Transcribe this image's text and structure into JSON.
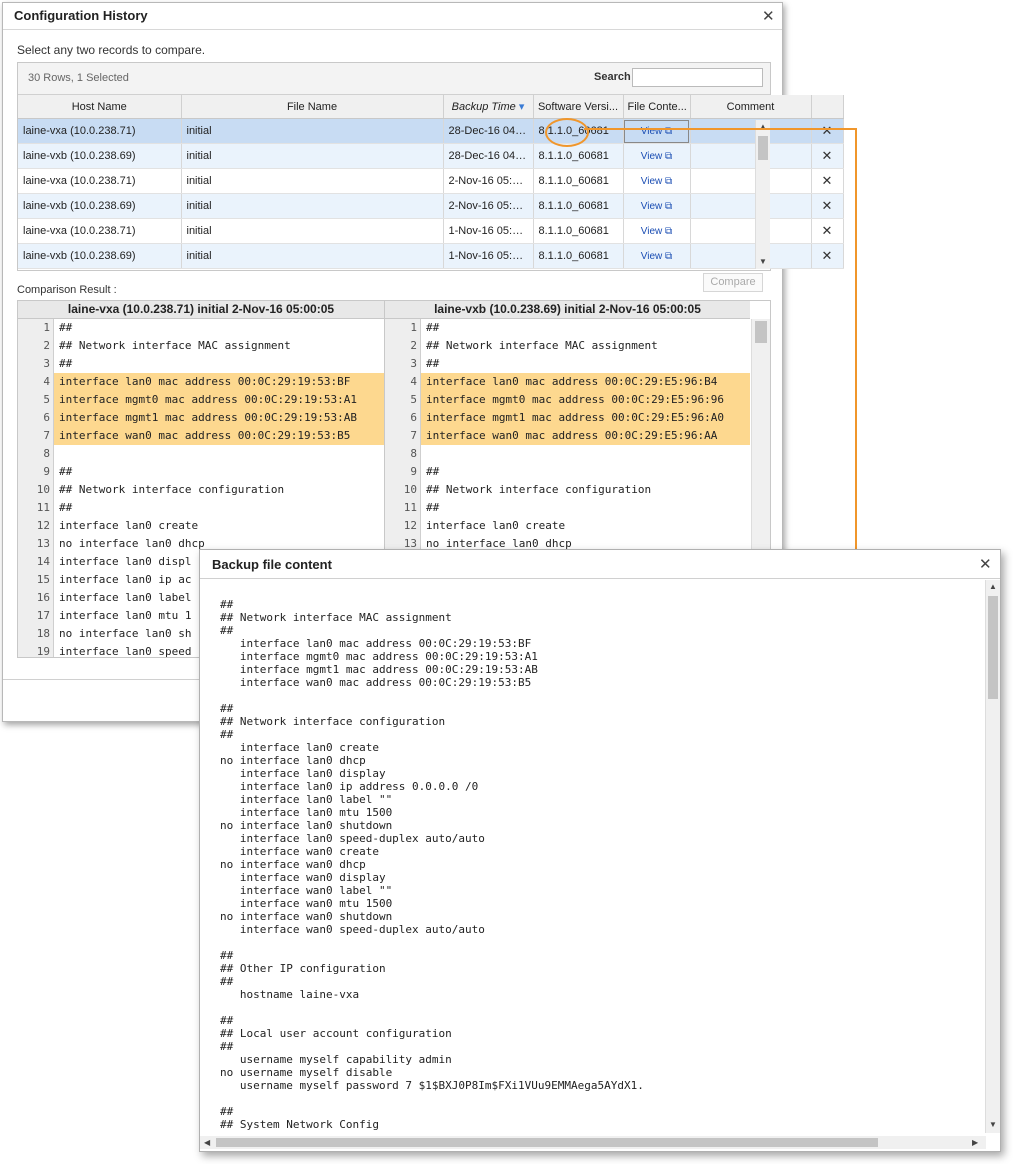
{
  "history": {
    "title": "Configuration History",
    "close_glyph": "✕",
    "instruction": "Select any two records to compare.",
    "rows_info": "30 Rows, 1 Selected",
    "search_label": "Search",
    "search_value": "",
    "columns": [
      "Host Name",
      "File Name",
      "Backup Time",
      "Software Versi...",
      "File Conte...",
      "Comment",
      ""
    ],
    "sort_indicator": "▾",
    "rows": [
      {
        "host": "laine-vxa (10.0.238.71)",
        "file": "initial",
        "time": "28-Dec-16 04:0...",
        "version": "8.1.1.0_60681",
        "content": "View ⧉",
        "comment": "",
        "delete": "✕"
      },
      {
        "host": "laine-vxb (10.0.238.69)",
        "file": "initial",
        "time": "28-Dec-16 04:00:...",
        "version": "8.1.1.0_60681",
        "content": "View ⧉",
        "comment": "",
        "delete": "✕"
      },
      {
        "host": "laine-vxa (10.0.238.71)",
        "file": "initial",
        "time": "2-Nov-16 05:00:...",
        "version": "8.1.1.0_60681",
        "content": "View ⧉",
        "comment": "",
        "delete": "✕"
      },
      {
        "host": "laine-vxb (10.0.238.69)",
        "file": "initial",
        "time": "2-Nov-16 05:00:...",
        "version": "8.1.1.0_60681",
        "content": "View ⧉",
        "comment": "",
        "delete": "✕"
      },
      {
        "host": "laine-vxa (10.0.238.71)",
        "file": "initial",
        "time": "1-Nov-16 05:00:...",
        "version": "8.1.1.0_60681",
        "content": "View ⧉",
        "comment": "",
        "delete": "✕"
      },
      {
        "host": "laine-vxb (10.0.238.69)",
        "file": "initial",
        "time": "1-Nov-16 05:00:...",
        "version": "8.1.1.0_60681",
        "content": "View ⧉",
        "comment": "",
        "delete": "✕"
      }
    ],
    "compare_label": "Compare",
    "comparison_label": "Comparison Result :",
    "left_header": "laine-vxa (10.0.238.71) initial 2-Nov-16 05:00:05",
    "right_header": "laine-vxb (10.0.238.69) initial 2-Nov-16 05:00:05",
    "left_lines": [
      {
        "n": "1",
        "t": "##",
        "hl": false
      },
      {
        "n": "2",
        "t": "## Network interface MAC assignment",
        "hl": false
      },
      {
        "n": "3",
        "t": "##",
        "hl": false
      },
      {
        "n": "4",
        "t": "interface lan0 mac address 00:0C:29:19:53:BF",
        "hl": true
      },
      {
        "n": "5",
        "t": "interface mgmt0 mac address 00:0C:29:19:53:A1",
        "hl": true
      },
      {
        "n": "6",
        "t": "interface mgmt1 mac address 00:0C:29:19:53:AB",
        "hl": true
      },
      {
        "n": "7",
        "t": "interface wan0 mac address 00:0C:29:19:53:B5",
        "hl": true
      },
      {
        "n": "8",
        "t": "",
        "hl": false
      },
      {
        "n": "9",
        "t": "##",
        "hl": false
      },
      {
        "n": "10",
        "t": "## Network interface configuration",
        "hl": false
      },
      {
        "n": "11",
        "t": "##",
        "hl": false
      },
      {
        "n": "12",
        "t": "interface lan0 create",
        "hl": false
      },
      {
        "n": "13",
        "t": "no interface lan0 dhcp",
        "hl": false
      },
      {
        "n": "14",
        "t": "interface lan0 displ",
        "hl": false
      },
      {
        "n": "15",
        "t": "interface lan0 ip ac",
        "hl": false
      },
      {
        "n": "16",
        "t": "interface lan0 label",
        "hl": false
      },
      {
        "n": "17",
        "t": "interface lan0 mtu 1",
        "hl": false
      },
      {
        "n": "18",
        "t": "no interface lan0 sh",
        "hl": false
      },
      {
        "n": "19",
        "t": "interface lan0 speed",
        "hl": false
      }
    ],
    "right_lines": [
      {
        "n": "1",
        "t": "##",
        "hl": false
      },
      {
        "n": "2",
        "t": "## Network interface MAC assignment",
        "hl": false
      },
      {
        "n": "3",
        "t": "##",
        "hl": false
      },
      {
        "n": "4",
        "t": "interface lan0 mac address 00:0C:29:E5:96:B4",
        "hl": true
      },
      {
        "n": "5",
        "t": "interface mgmt0 mac address 00:0C:29:E5:96:96",
        "hl": true
      },
      {
        "n": "6",
        "t": "interface mgmt1 mac address 00:0C:29:E5:96:A0",
        "hl": true
      },
      {
        "n": "7",
        "t": "interface wan0 mac address 00:0C:29:E5:96:AA",
        "hl": true
      },
      {
        "n": "8",
        "t": "",
        "hl": false
      },
      {
        "n": "10",
        "t": "## Network interface configuration",
        "hl": false
      },
      {
        "n": "11",
        "t": "##",
        "hl": false
      },
      {
        "n": "12",
        "t": "interface lan0 create",
        "hl": false
      },
      {
        "n": "13",
        "t": "no interface lan0 dhcp",
        "hl": false
      }
    ],
    "right_line9": {
      "n": "9",
      "t": "##"
    }
  },
  "backup": {
    "title": "Backup file content",
    "close_glyph": "✕",
    "lines": [
      "##",
      "## Network interface MAC assignment",
      "##",
      "   interface lan0 mac address 00:0C:29:19:53:BF",
      "   interface mgmt0 mac address 00:0C:29:19:53:A1",
      "   interface mgmt1 mac address 00:0C:29:19:53:AB",
      "   interface wan0 mac address 00:0C:29:19:53:B5",
      "",
      "##",
      "## Network interface configuration",
      "##",
      "   interface lan0 create",
      "no interface lan0 dhcp",
      "   interface lan0 display",
      "   interface lan0 ip address 0.0.0.0 /0",
      "   interface lan0 label \"\"",
      "   interface lan0 mtu 1500",
      "no interface lan0 shutdown",
      "   interface lan0 speed-duplex auto/auto",
      "   interface wan0 create",
      "no interface wan0 dhcp",
      "   interface wan0 display",
      "   interface wan0 label \"\"",
      "   interface wan0 mtu 1500",
      "no interface wan0 shutdown",
      "   interface wan0 speed-duplex auto/auto",
      "",
      "##",
      "## Other IP configuration",
      "##",
      "   hostname laine-vxa",
      "",
      "##",
      "## Local user account configuration",
      "##",
      "   username myself capability admin",
      "no username myself disable",
      "   username myself password 7 $1$BXJ0P8Im$FXi1VUu9EMMAega5AYdX1.",
      "",
      "##",
      "## System Network Config"
    ]
  }
}
